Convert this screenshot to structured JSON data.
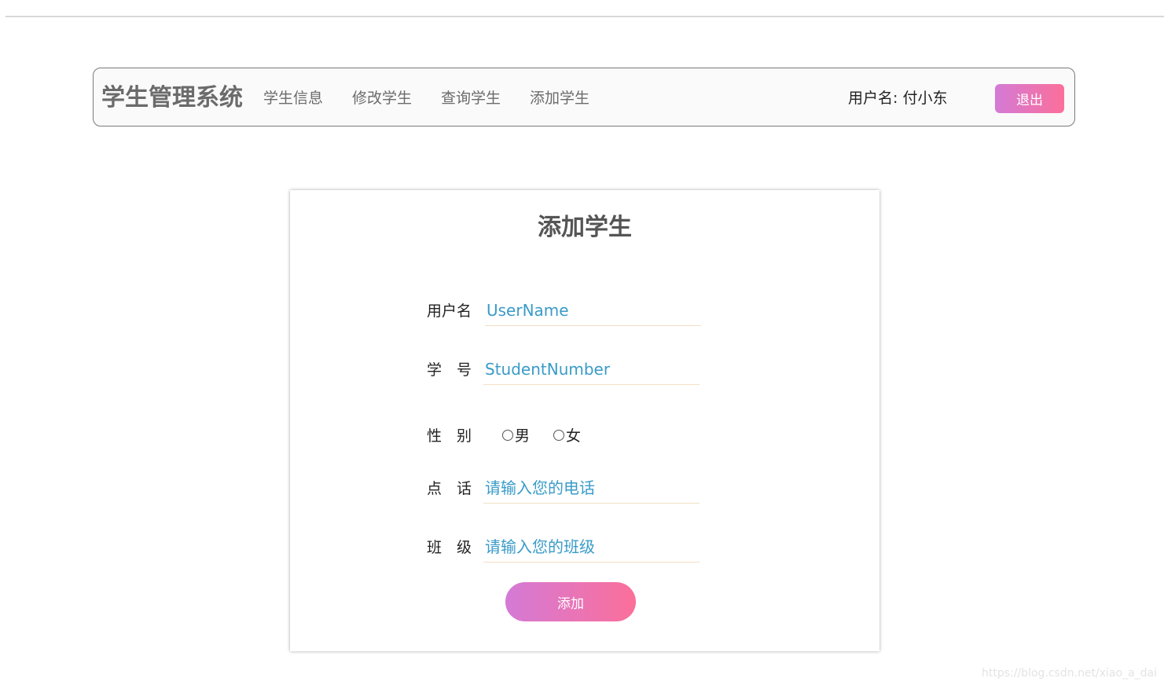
{
  "navbar": {
    "brand": "学生管理系统",
    "links": [
      "学生信息",
      "修改学生",
      "查询学生",
      "添加学生"
    ],
    "user_label": "用户名: 付小东",
    "logout_label": "退出"
  },
  "form": {
    "title": "添加学生",
    "username": {
      "label": "用户名",
      "placeholder": "UserName"
    },
    "student_number": {
      "label": "学　号",
      "placeholder": "StudentNumber"
    },
    "gender": {
      "label": "性　别",
      "options": [
        "男",
        "女"
      ]
    },
    "phone": {
      "label": "点　话",
      "placeholder": "请输入您的电话"
    },
    "class": {
      "label": "班　级",
      "placeholder": "请输入您的班级"
    },
    "submit_label": "添加"
  },
  "watermark": "https://blog.csdn.net/xiao_a_dai",
  "colors": {
    "gradient_start": "#d47ad6",
    "gradient_end": "#fb6f9a",
    "input_text": "#3a9bc8"
  }
}
